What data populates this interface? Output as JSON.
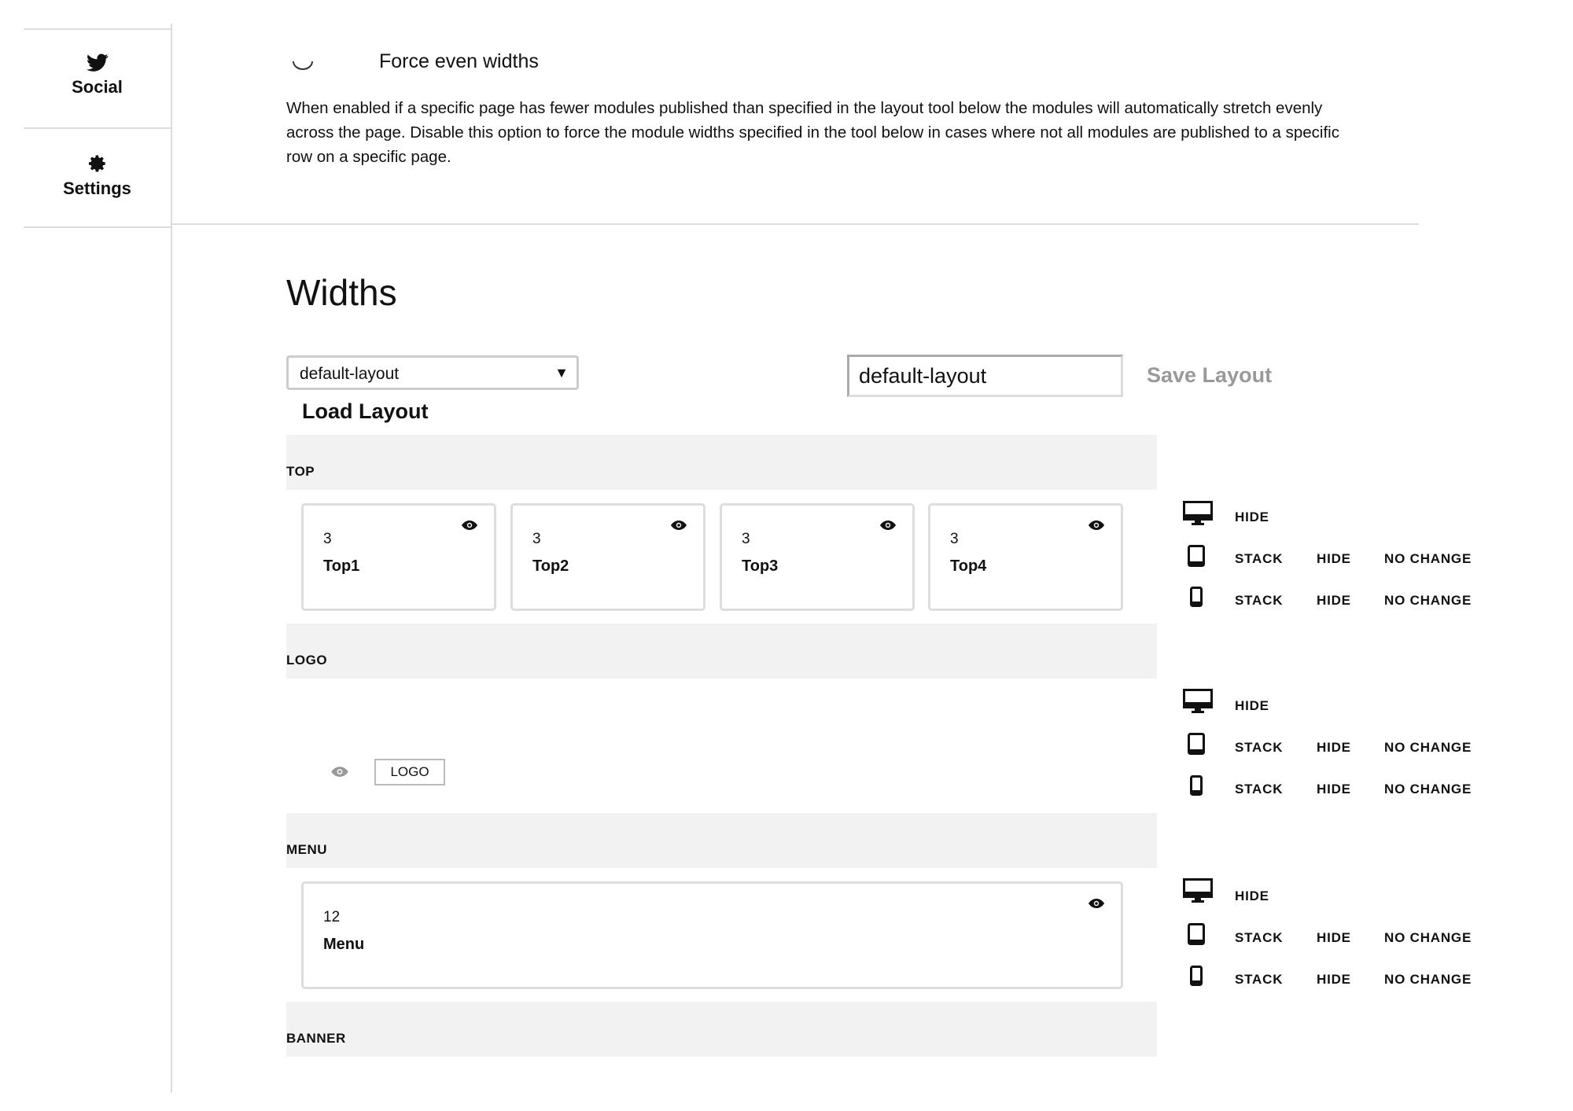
{
  "sidebar": {
    "items": [
      {
        "label": "Social",
        "icon": "twitter-icon"
      },
      {
        "label": "Settings",
        "icon": "gear-icon"
      }
    ]
  },
  "force_even": {
    "label": "Force even widths",
    "description": "When enabled if a specific page has fewer modules published than specified in the layout tool below the modules will automatically stretch evenly across the page. Disable this option to force the module widths specified in the tool below in cases where not all modules are published to a specific row on a specific page."
  },
  "widths": {
    "title": "Widths",
    "layout_select": {
      "value": "default-layout",
      "arrow": "▼"
    },
    "load_label": "Load Layout",
    "layout_name_input": {
      "value": "default-layout"
    },
    "save_label": "Save Layout"
  },
  "rows": [
    {
      "label": "TOP",
      "modules": [
        {
          "size": "3",
          "name": "Top1"
        },
        {
          "size": "3",
          "name": "Top2"
        },
        {
          "size": "3",
          "name": "Top3"
        },
        {
          "size": "3",
          "name": "Top4"
        }
      ]
    },
    {
      "label": "LOGO",
      "unpublished_tag": "LOGO"
    },
    {
      "label": "MENU",
      "modules": [
        {
          "size": "12",
          "name": "Menu"
        }
      ]
    },
    {
      "label": "BANNER"
    }
  ],
  "device_options": {
    "desktop": [
      "HIDE"
    ],
    "tablet": [
      "STACK",
      "HIDE",
      "NO CHANGE"
    ],
    "phone": [
      "STACK",
      "HIDE",
      "NO CHANGE"
    ]
  },
  "colors": {
    "row_bg": "#f2f2f2",
    "border": "#dddddd",
    "muted_text": "#999999"
  }
}
